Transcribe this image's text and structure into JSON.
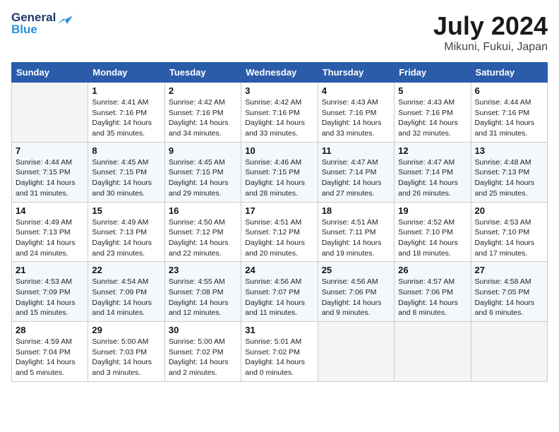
{
  "header": {
    "logo_line1": "General",
    "logo_line2": "Blue",
    "month": "July 2024",
    "location": "Mikuni, Fukui, Japan"
  },
  "weekdays": [
    "Sunday",
    "Monday",
    "Tuesday",
    "Wednesday",
    "Thursday",
    "Friday",
    "Saturday"
  ],
  "weeks": [
    [
      {
        "day": "",
        "info": ""
      },
      {
        "day": "1",
        "info": "Sunrise: 4:41 AM\nSunset: 7:16 PM\nDaylight: 14 hours\nand 35 minutes."
      },
      {
        "day": "2",
        "info": "Sunrise: 4:42 AM\nSunset: 7:16 PM\nDaylight: 14 hours\nand 34 minutes."
      },
      {
        "day": "3",
        "info": "Sunrise: 4:42 AM\nSunset: 7:16 PM\nDaylight: 14 hours\nand 33 minutes."
      },
      {
        "day": "4",
        "info": "Sunrise: 4:43 AM\nSunset: 7:16 PM\nDaylight: 14 hours\nand 33 minutes."
      },
      {
        "day": "5",
        "info": "Sunrise: 4:43 AM\nSunset: 7:16 PM\nDaylight: 14 hours\nand 32 minutes."
      },
      {
        "day": "6",
        "info": "Sunrise: 4:44 AM\nSunset: 7:16 PM\nDaylight: 14 hours\nand 31 minutes."
      }
    ],
    [
      {
        "day": "7",
        "info": "Sunrise: 4:44 AM\nSunset: 7:15 PM\nDaylight: 14 hours\nand 31 minutes."
      },
      {
        "day": "8",
        "info": "Sunrise: 4:45 AM\nSunset: 7:15 PM\nDaylight: 14 hours\nand 30 minutes."
      },
      {
        "day": "9",
        "info": "Sunrise: 4:45 AM\nSunset: 7:15 PM\nDaylight: 14 hours\nand 29 minutes."
      },
      {
        "day": "10",
        "info": "Sunrise: 4:46 AM\nSunset: 7:15 PM\nDaylight: 14 hours\nand 28 minutes."
      },
      {
        "day": "11",
        "info": "Sunrise: 4:47 AM\nSunset: 7:14 PM\nDaylight: 14 hours\nand 27 minutes."
      },
      {
        "day": "12",
        "info": "Sunrise: 4:47 AM\nSunset: 7:14 PM\nDaylight: 14 hours\nand 26 minutes."
      },
      {
        "day": "13",
        "info": "Sunrise: 4:48 AM\nSunset: 7:13 PM\nDaylight: 14 hours\nand 25 minutes."
      }
    ],
    [
      {
        "day": "14",
        "info": "Sunrise: 4:49 AM\nSunset: 7:13 PM\nDaylight: 14 hours\nand 24 minutes."
      },
      {
        "day": "15",
        "info": "Sunrise: 4:49 AM\nSunset: 7:13 PM\nDaylight: 14 hours\nand 23 minutes."
      },
      {
        "day": "16",
        "info": "Sunrise: 4:50 AM\nSunset: 7:12 PM\nDaylight: 14 hours\nand 22 minutes."
      },
      {
        "day": "17",
        "info": "Sunrise: 4:51 AM\nSunset: 7:12 PM\nDaylight: 14 hours\nand 20 minutes."
      },
      {
        "day": "18",
        "info": "Sunrise: 4:51 AM\nSunset: 7:11 PM\nDaylight: 14 hours\nand 19 minutes."
      },
      {
        "day": "19",
        "info": "Sunrise: 4:52 AM\nSunset: 7:10 PM\nDaylight: 14 hours\nand 18 minutes."
      },
      {
        "day": "20",
        "info": "Sunrise: 4:53 AM\nSunset: 7:10 PM\nDaylight: 14 hours\nand 17 minutes."
      }
    ],
    [
      {
        "day": "21",
        "info": "Sunrise: 4:53 AM\nSunset: 7:09 PM\nDaylight: 14 hours\nand 15 minutes."
      },
      {
        "day": "22",
        "info": "Sunrise: 4:54 AM\nSunset: 7:09 PM\nDaylight: 14 hours\nand 14 minutes."
      },
      {
        "day": "23",
        "info": "Sunrise: 4:55 AM\nSunset: 7:08 PM\nDaylight: 14 hours\nand 12 minutes."
      },
      {
        "day": "24",
        "info": "Sunrise: 4:56 AM\nSunset: 7:07 PM\nDaylight: 14 hours\nand 11 minutes."
      },
      {
        "day": "25",
        "info": "Sunrise: 4:56 AM\nSunset: 7:06 PM\nDaylight: 14 hours\nand 9 minutes."
      },
      {
        "day": "26",
        "info": "Sunrise: 4:57 AM\nSunset: 7:06 PM\nDaylight: 14 hours\nand 8 minutes."
      },
      {
        "day": "27",
        "info": "Sunrise: 4:58 AM\nSunset: 7:05 PM\nDaylight: 14 hours\nand 6 minutes."
      }
    ],
    [
      {
        "day": "28",
        "info": "Sunrise: 4:59 AM\nSunset: 7:04 PM\nDaylight: 14 hours\nand 5 minutes."
      },
      {
        "day": "29",
        "info": "Sunrise: 5:00 AM\nSunset: 7:03 PM\nDaylight: 14 hours\nand 3 minutes."
      },
      {
        "day": "30",
        "info": "Sunrise: 5:00 AM\nSunset: 7:02 PM\nDaylight: 14 hours\nand 2 minutes."
      },
      {
        "day": "31",
        "info": "Sunrise: 5:01 AM\nSunset: 7:02 PM\nDaylight: 14 hours\nand 0 minutes."
      },
      {
        "day": "",
        "info": ""
      },
      {
        "day": "",
        "info": ""
      },
      {
        "day": "",
        "info": ""
      }
    ]
  ]
}
